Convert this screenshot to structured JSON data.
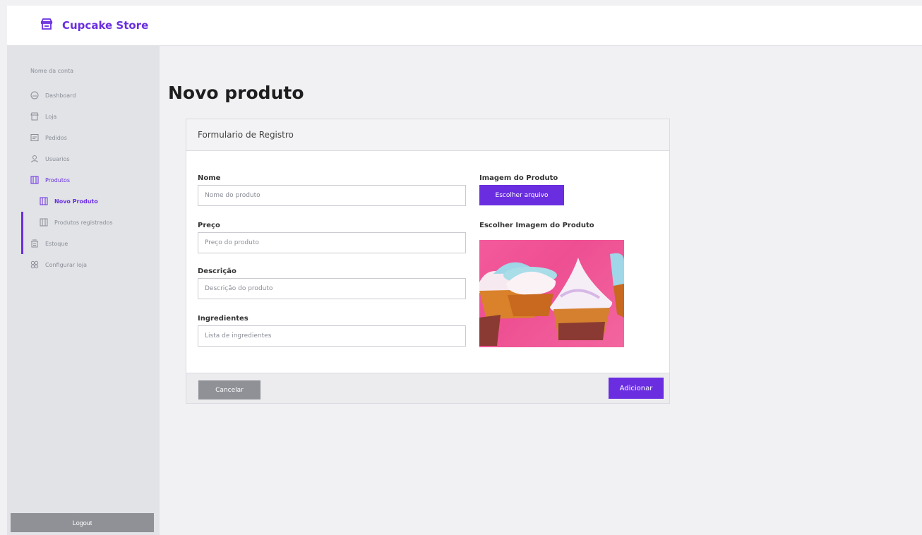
{
  "app": {
    "brand": "Cupcake Store",
    "brand_icon": "shop-icon",
    "accent_color": "#6a2ee0"
  },
  "sidebar": {
    "section_label": "Nome da conta",
    "items": [
      {
        "label": "Dashboard",
        "icon": "dashboard-icon"
      },
      {
        "label": "Loja",
        "icon": "store-icon"
      },
      {
        "label": "Pedidos",
        "icon": "orders-icon"
      },
      {
        "label": "Usuarios",
        "icon": "user-icon"
      },
      {
        "label": "Produtos",
        "icon": "products-icon",
        "active": true
      },
      {
        "label": "Novo Produto",
        "icon": "products-icon",
        "sub": true,
        "active": true
      },
      {
        "label": "Produtos registrados",
        "icon": "products-icon",
        "sub": true
      },
      {
        "label": "Estoque",
        "icon": "stock-icon"
      },
      {
        "label": "Configurar loja",
        "icon": "settings-icon"
      }
    ],
    "logout_label": "Logout"
  },
  "page": {
    "title": "Novo produto"
  },
  "form": {
    "header": "Formulario de Registro",
    "fields": {
      "name": {
        "label": "Nome",
        "placeholder": "Nome do produto"
      },
      "price": {
        "label": "Preço",
        "placeholder": "Preço do produto"
      },
      "description": {
        "label": "Descrição",
        "placeholder": "Descrição do produto"
      },
      "ingredients": {
        "label": "Ingredientes",
        "placeholder": "Lista de ingredientes"
      }
    },
    "image": {
      "label": "Imagem do Produto",
      "choose_button": "Escolher arquivo",
      "preview_label": "Escolher Imagem do Produto"
    },
    "cancel_label": "Cancelar",
    "add_label": "Adicionar"
  }
}
